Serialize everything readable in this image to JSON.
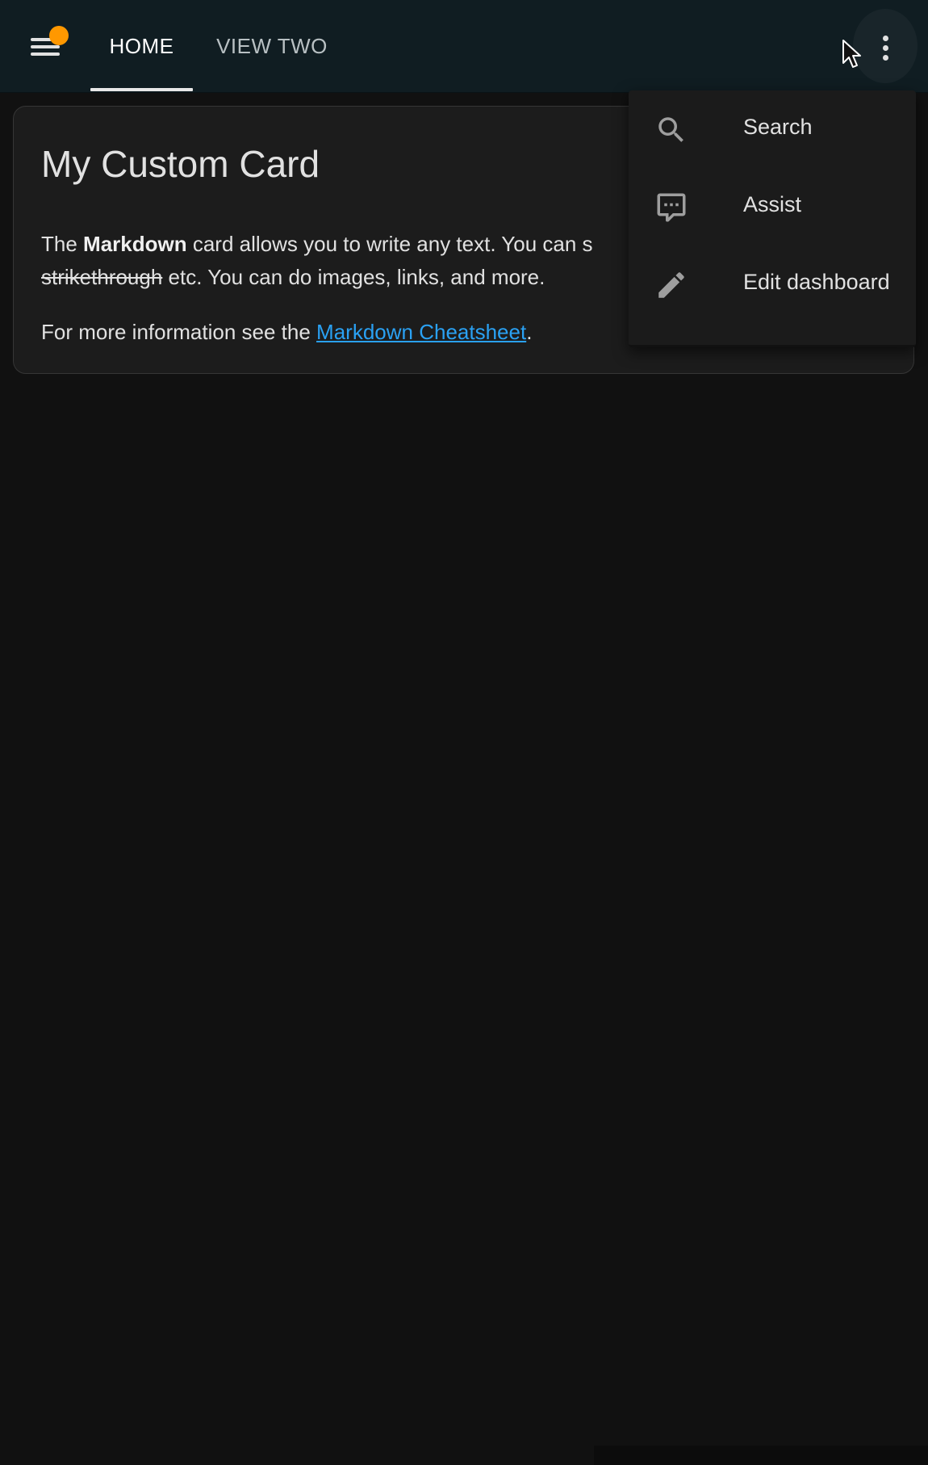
{
  "header": {
    "tabs": [
      {
        "label": "HOME",
        "active": true
      },
      {
        "label": "VIEW TWO",
        "active": false
      }
    ],
    "menu_icon": "menu-icon",
    "notification_color": "#ff9800",
    "more_icon": "dots-vertical-icon"
  },
  "card": {
    "title": "My Custom Card",
    "line1": {
      "prefix": "The ",
      "bold": "Markdown",
      "suffix": " card allows you to write any text. You can s"
    },
    "line2": {
      "strike": "strikethrough",
      "suffix": " etc. You can do images, links, and more."
    },
    "line3": {
      "prefix": "For more information see the ",
      "link": "Markdown Cheatsheet",
      "suffix": "."
    }
  },
  "dropdown": {
    "items": [
      {
        "label": "Search",
        "icon": "search-icon"
      },
      {
        "label": "Assist",
        "icon": "comment-processing-icon"
      },
      {
        "label": "Edit dashboard",
        "icon": "pencil-icon"
      }
    ]
  },
  "colors": {
    "background": "#111111",
    "header": "#101d22",
    "card": "#1c1c1c",
    "link": "#2aa1f3",
    "accent": "#ff9800"
  }
}
